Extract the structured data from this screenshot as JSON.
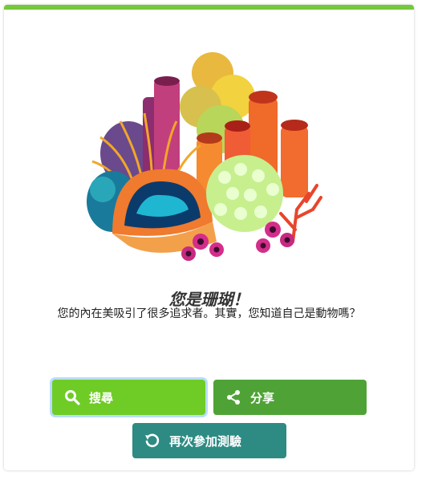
{
  "result": {
    "title": "您是珊瑚！",
    "description": "您的內在美吸引了很多追求者。其實，您知道自己是動物嗎？"
  },
  "buttons": {
    "search": {
      "label": "搜尋",
      "icon": "search-icon"
    },
    "share": {
      "label": "分享",
      "icon": "share-icon"
    },
    "retry": {
      "label": "再次參加測驗",
      "icon": "retry-icon"
    }
  },
  "colors": {
    "accent_bar": "#74c93a",
    "search_button": "#6fcc26",
    "share_button": "#4fa336",
    "retry_button": "#2d8b83"
  }
}
